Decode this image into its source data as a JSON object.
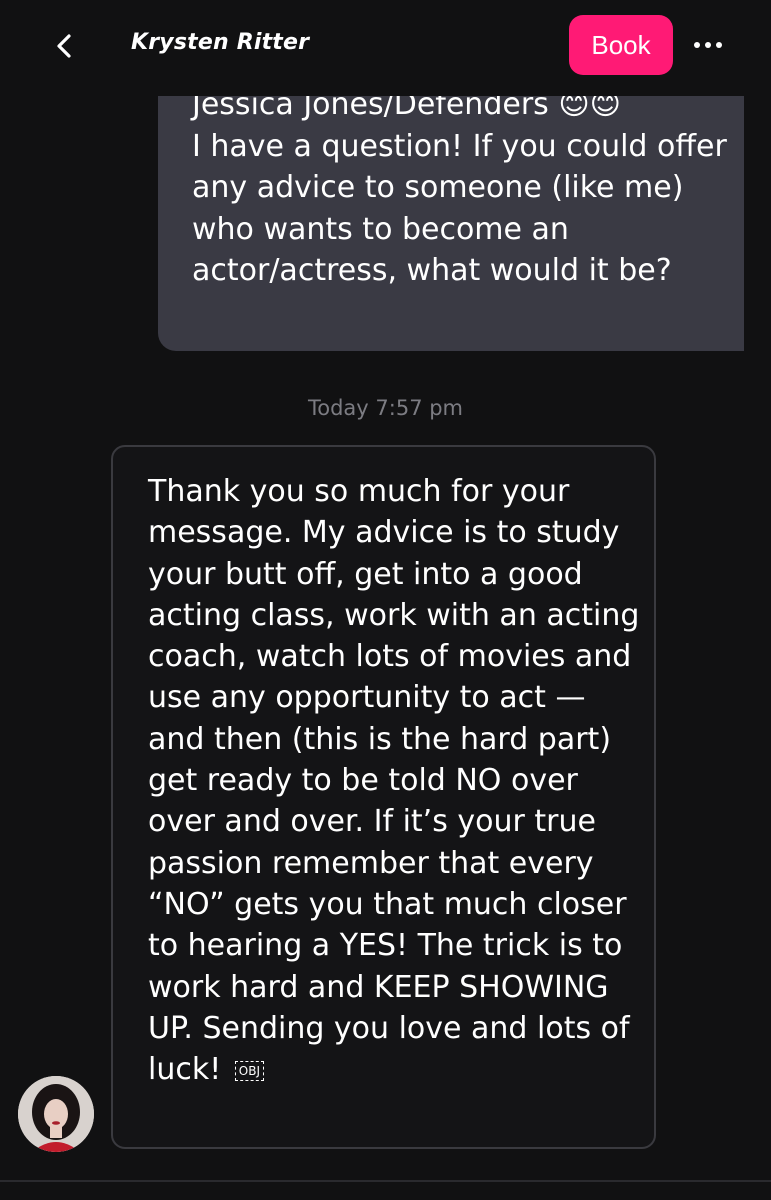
{
  "header": {
    "contact_name": "Krysten Ritter",
    "book_label": "Book"
  },
  "messages": {
    "sent": {
      "text": "Jessica Jones/Defenders 😊😊\nI have a question! If you could offer any advice to someone (like me) who wants to become an actor/actress, what would it be?"
    },
    "timestamp": "Today 7:57 pm",
    "received": {
      "text": "Thank you so much for your message. My advice is to study your butt off, get into a good acting class, work with an acting coach, watch lots of movies and use any opportunity to act — and then (this is the hard part) get ready to be told NO over over and over. If it’s your true passion remember that every “NO” gets you that much closer to hearing a YES! The trick is to work hard and KEEP SHOWING UP. Sending you love and lots of luck!",
      "obj_glyph": "OBJ"
    }
  },
  "colors": {
    "accent": "#ff1a75",
    "background": "#111112",
    "sent_bubble": "#3a3a44",
    "timestamp": "#7c7c82"
  },
  "icons": {
    "back": "chevron-left-icon",
    "more": "more-horizontal-icon"
  }
}
